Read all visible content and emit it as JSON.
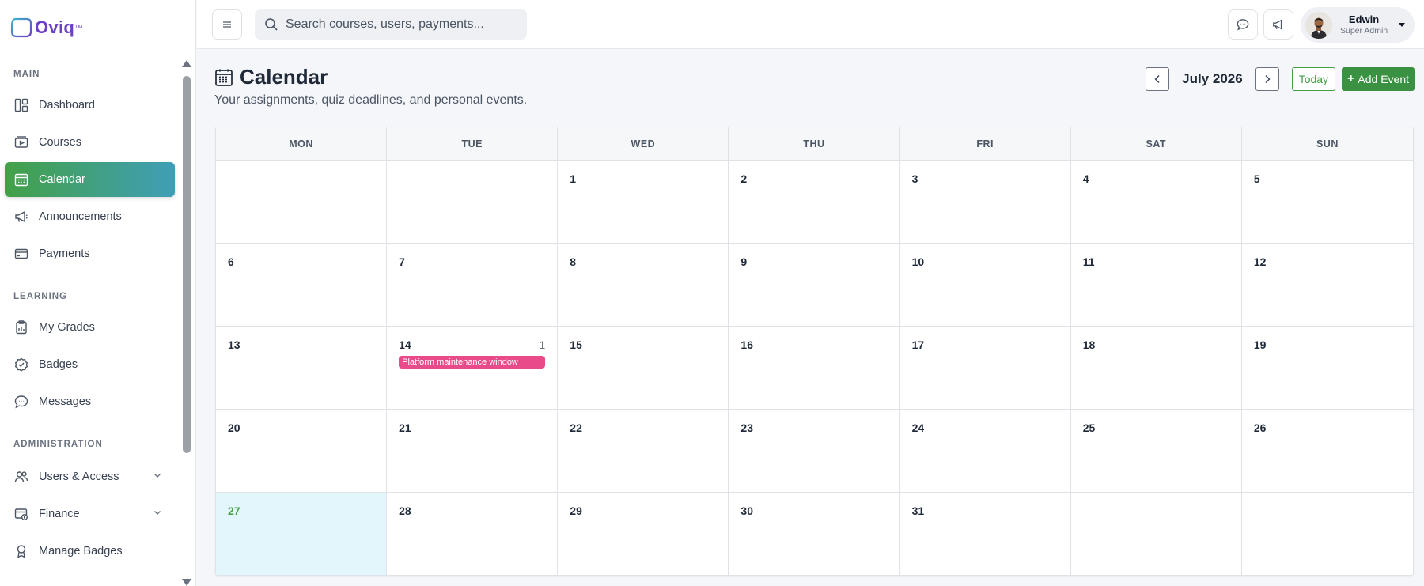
{
  "brand": {
    "name": "Oviq",
    "tm": "TM"
  },
  "sidebar": {
    "sections": [
      {
        "title": "MAIN",
        "items": [
          {
            "label": "Dashboard",
            "icon": "dashboard-icon"
          },
          {
            "label": "Courses",
            "icon": "courses-icon"
          },
          {
            "label": "Calendar",
            "icon": "calendar-icon",
            "active": true
          },
          {
            "label": "Announcements",
            "icon": "megaphone-icon"
          },
          {
            "label": "Payments",
            "icon": "credit-card-icon"
          }
        ]
      },
      {
        "title": "LEARNING",
        "items": [
          {
            "label": "My Grades",
            "icon": "grades-icon"
          },
          {
            "label": "Badges",
            "icon": "badge-icon"
          },
          {
            "label": "Messages",
            "icon": "chat-icon"
          }
        ]
      },
      {
        "title": "ADMINISTRATION",
        "items": [
          {
            "label": "Users & Access",
            "icon": "users-icon",
            "expandable": true
          },
          {
            "label": "Finance",
            "icon": "finance-icon",
            "expandable": true
          },
          {
            "label": "Manage Badges",
            "icon": "award-icon"
          }
        ]
      }
    ]
  },
  "header": {
    "search_placeholder": "Search courses, users, payments...",
    "user": {
      "name": "Edwin",
      "role": "Super Admin"
    }
  },
  "page": {
    "title": "Calendar",
    "subtitle": "Your assignments, quiz deadlines, and personal events.",
    "month": "July 2026",
    "today_label": "Today",
    "add_label": "Add Event"
  },
  "calendar": {
    "weekdays": [
      "MON",
      "TUE",
      "WED",
      "THU",
      "FRI",
      "SAT",
      "SUN"
    ],
    "days": [
      "",
      "",
      "1",
      "2",
      "3",
      "4",
      "5",
      "6",
      "7",
      "8",
      "9",
      "10",
      "11",
      "12",
      "13",
      "14",
      "15",
      "16",
      "17",
      "18",
      "19",
      "20",
      "21",
      "22",
      "23",
      "24",
      "25",
      "26",
      "27",
      "28",
      "29",
      "30",
      "31",
      "",
      ""
    ],
    "today": "27",
    "events": [
      {
        "day": "14",
        "count": "1",
        "title": "Platform maintenance window",
        "color": "#e94a8a"
      }
    ]
  },
  "colors": {
    "accent_green": "#43a047",
    "accent_teal": "#3f9fb7",
    "event_pink": "#e94a8a",
    "today_bg": "#e3f6fb"
  }
}
